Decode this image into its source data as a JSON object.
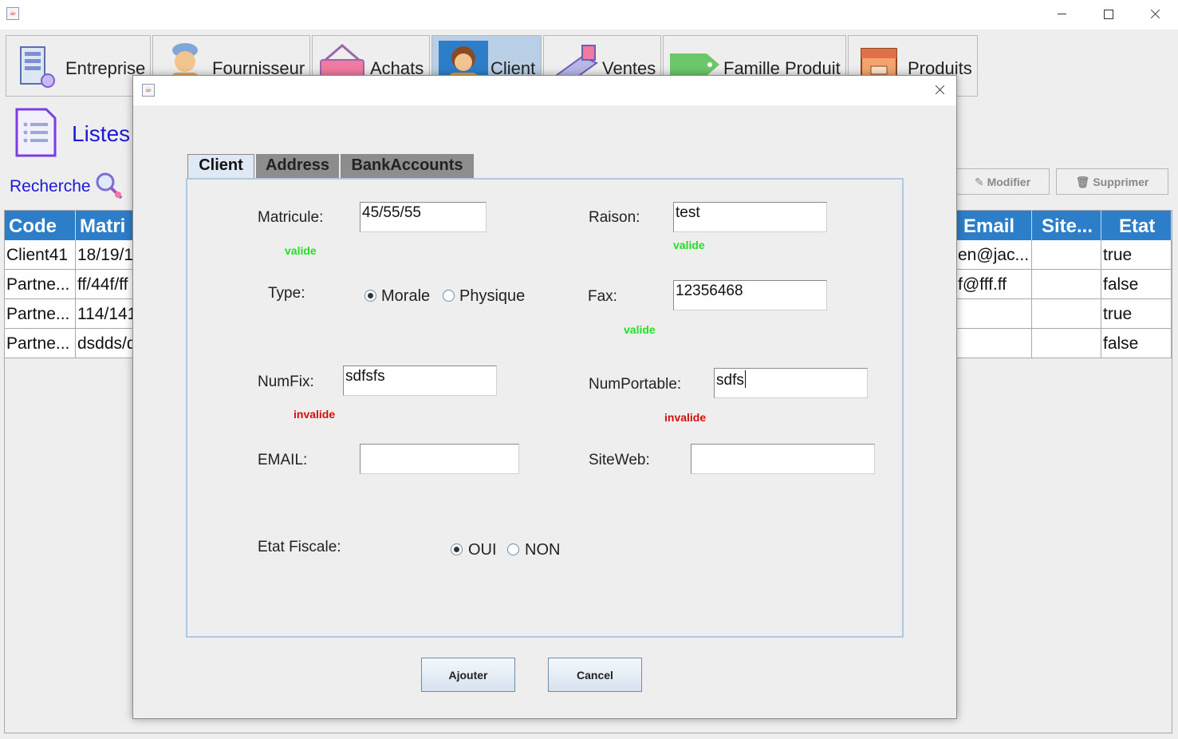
{
  "app": {
    "icon": "java-cup-icon"
  },
  "module_tabs": [
    {
      "label": "Entreprise",
      "icon": "company-icon"
    },
    {
      "label": "Fournisseur",
      "icon": "supplier-person-icon"
    },
    {
      "label": "Achats",
      "icon": "shopping-basket-icon"
    },
    {
      "label": "Client",
      "icon": "client-person-icon",
      "active": true
    },
    {
      "label": "Ventes",
      "icon": "sales-icon"
    },
    {
      "label": "Famille Produit",
      "icon": "tag-icon"
    },
    {
      "label": "Produits",
      "icon": "product-box-icon"
    }
  ],
  "left": {
    "listes_label": "Listes",
    "recherche_label": "Recherche"
  },
  "actions": {
    "modifier": "Modifier",
    "supprimer": "Supprimer"
  },
  "table": {
    "columns": [
      "Code",
      "Matri",
      "Email",
      "Site...",
      "Etat"
    ],
    "rows": [
      {
        "code": "Client41",
        "matricule": "18/19/1",
        "email": "en@jac...",
        "site": "",
        "etat": "true"
      },
      {
        "code": "Partne...",
        "matricule": "ff/44f/ff",
        "email": "f@fff.ff",
        "site": "",
        "etat": "false"
      },
      {
        "code": "Partne...",
        "matricule": "114/141",
        "email": "",
        "site": "",
        "etat": "true"
      },
      {
        "code": "Partne...",
        "matricule": "dsdds/d",
        "email": "",
        "site": "",
        "etat": "false"
      }
    ]
  },
  "dialog": {
    "tabs": [
      "Client",
      "Address",
      "BankAccounts"
    ],
    "form": {
      "matricule_label": "Matricule:",
      "matricule_value": "45/55/55",
      "matricule_status": "valide",
      "raison_label": "Raison:",
      "raison_value": "test",
      "raison_status": "valide",
      "type_label": "Type:",
      "type_options": [
        "Morale",
        "Physique"
      ],
      "type_selected": "Morale",
      "fax_label": "Fax:",
      "fax_value": "12356468",
      "fax_status": "valide",
      "numfix_label": "NumFix:",
      "numfix_value": "sdfsfs",
      "numfix_status": "invalide",
      "numportable_label": "NumPortable:",
      "numportable_value": "sdfs",
      "numportable_status": "invalide",
      "email_label": "EMAIL:",
      "email_value": "",
      "siteweb_label": "SiteWeb:",
      "siteweb_value": "",
      "etat_label": "Etat Fiscale:",
      "etat_options": [
        "OUI",
        "NON"
      ],
      "etat_selected": "OUI"
    },
    "buttons": {
      "ajouter": "Ajouter",
      "cancel": "Cancel"
    }
  },
  "colors": {
    "table_header": "#2c7ec9",
    "link_blue": "#1a1ad6",
    "valid_green": "#22e022",
    "invalid_red": "#d40d0d",
    "active_tab": "#b8cfe5"
  }
}
